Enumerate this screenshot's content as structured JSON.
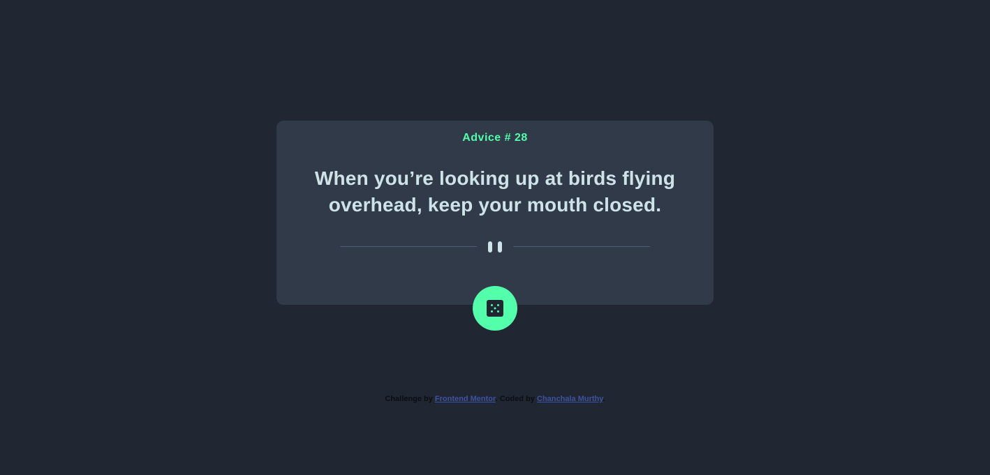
{
  "advice": {
    "id_label": "Advice # 28",
    "text": "When you’re looking up at birds flying overhead, keep your mouth closed."
  },
  "icons": {
    "divider": "pause-icon",
    "button": "dice-icon"
  },
  "colors": {
    "background": "#202632",
    "card": "#313a48",
    "accent": "#53ffaa",
    "text": "#cee3e9",
    "divider": "#4f5d74",
    "link": "#3e52a3"
  },
  "footer": {
    "challenge_prefix": "Challenge by",
    "challenge_link": "Frontend Mentor",
    "coded_prefix": "Coded by",
    "coded_link": "Chanchala Murthy",
    "suffix": "."
  }
}
